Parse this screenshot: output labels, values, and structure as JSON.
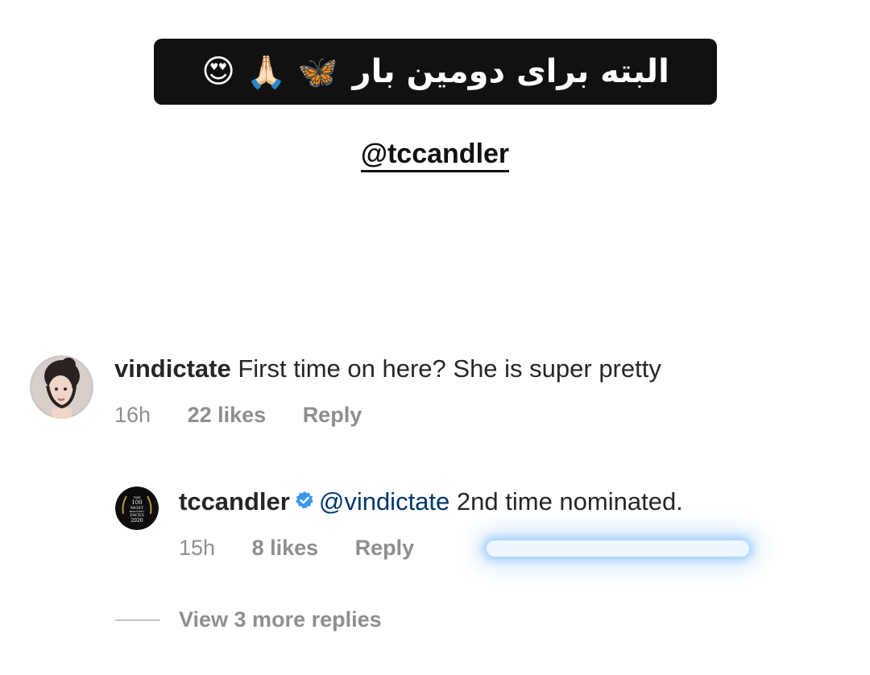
{
  "story": {
    "banner_text": "البته برای دومین بار",
    "banner_emojis": [
      "😍",
      "🙏🏻",
      "🦋"
    ],
    "mention": "@tccandler"
  },
  "comments": [
    {
      "username": "vindictate",
      "text": "First time on here? She is super pretty",
      "time": "16h",
      "likes": "22 likes",
      "reply_label": "Reply"
    },
    {
      "username": "tccandler",
      "verified": true,
      "mention": "@vindictate",
      "text": "2nd time nominated.",
      "time": "15h",
      "likes": "8 likes",
      "reply_label": "Reply"
    }
  ],
  "view_more_replies": "View 3 more replies",
  "badge_text": [
    "THE",
    "100",
    "MOST",
    "BEAUTIFUL",
    "FACES",
    "2020"
  ],
  "colors": {
    "verified_blue": "#3897f0",
    "link_blue": "#00376b",
    "meta_gray": "#8e8e8e",
    "highlight_glow": "#78b4ff"
  }
}
